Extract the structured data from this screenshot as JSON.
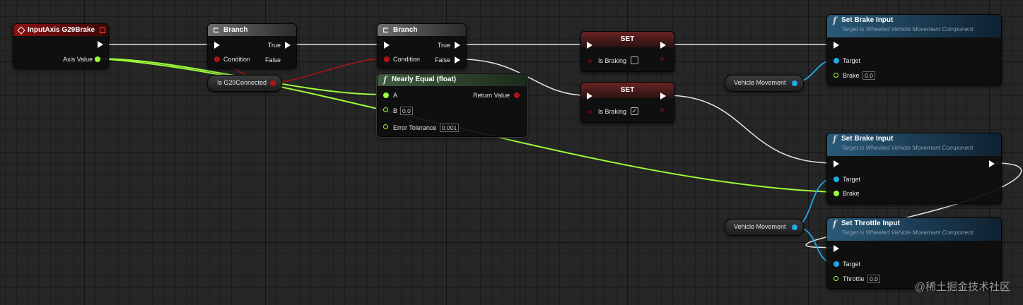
{
  "nodes": {
    "input_axis": {
      "title": "InputAxis G29Brake",
      "axis_value_label": "Axis Value"
    },
    "branch1": {
      "title": "Branch",
      "condition_label": "Condition",
      "true_label": "True",
      "false_label": "False"
    },
    "branch2": {
      "title": "Branch",
      "condition_label": "Condition",
      "true_label": "True",
      "false_label": "False"
    },
    "is_g29_connected": {
      "label": "Is G29Connected"
    },
    "nearly_equal": {
      "title": "Nearly Equal (float)",
      "a_label": "A",
      "b_label": "B",
      "b_value": "0.0",
      "tolerance_label": "Error Tolerance",
      "tolerance_value": "0.001",
      "return_label": "Return Value"
    },
    "set1": {
      "title": "SET",
      "var_label": "Is Braking",
      "checked": false
    },
    "set2": {
      "title": "SET",
      "var_label": "Is Braking",
      "checked": true,
      "check_glyph": "✓"
    },
    "set_brake1": {
      "title": "Set Brake Input",
      "subtitle": "Target is Wheeled Vehicle Movement Component",
      "target_label": "Target",
      "brake_label": "Brake",
      "brake_value": "0.0"
    },
    "set_brake2": {
      "title": "Set Brake Input",
      "subtitle": "Target is Wheeled Vehicle Movement Component",
      "target_label": "Target",
      "brake_label": "Brake"
    },
    "set_throttle": {
      "title": "Set Throttle Input",
      "subtitle": "Target is Wheeled Vehicle Movement Component",
      "target_label": "Target",
      "throttle_label": "Throttle",
      "throttle_value": "0.0"
    },
    "vehicle_movement1": {
      "label": "Vehicle Movement"
    },
    "vehicle_movement2": {
      "label": "Vehicle Movement"
    }
  },
  "icons": {
    "function": "f",
    "branch": "⊏",
    "event": "diamond-outline",
    "exec_pin": "white-triangle",
    "exec_pin_unconnected": "hollow-triangle"
  },
  "colors": {
    "exec_wire": "#e8e8e8",
    "float_wire": "#9dfc3a",
    "bool_wire": "#b01515",
    "object_wire": "#21a8e8",
    "event_header": "#8a1010",
    "function_header": "#295a78",
    "pure_header": "#3f5c3f"
  },
  "watermark": "@稀土掘金技术社区"
}
